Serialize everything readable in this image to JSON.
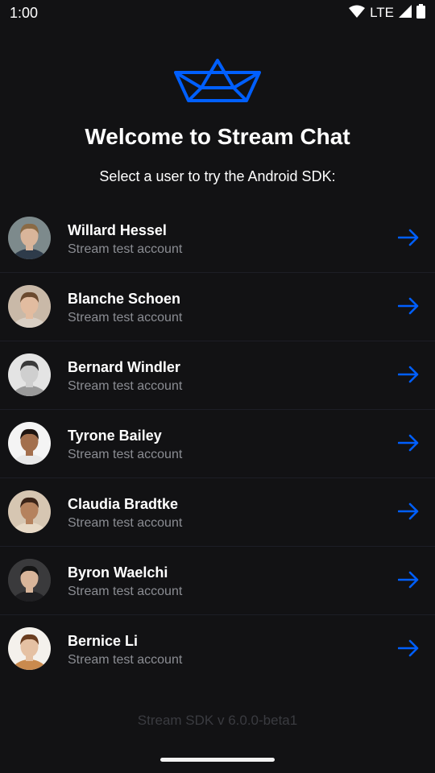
{
  "status_bar": {
    "time": "1:00",
    "network": "LTE",
    "icons": [
      "wifi-icon",
      "signal-icon",
      "battery-icon"
    ]
  },
  "logo_icon": "stream-boat-logo",
  "title": "Welcome to Stream Chat",
  "subtitle": "Select a user to try the Android SDK:",
  "users": [
    {
      "name": "Willard Hessel",
      "subtitle": "Stream test account",
      "skin": "#d9b59a",
      "hair": "#8a6a45",
      "bg": "#7d8a8c",
      "shirt": "#2e3b4a"
    },
    {
      "name": "Blanche Schoen",
      "subtitle": "Stream test account",
      "skin": "#e2bca0",
      "hair": "#6b4a2f",
      "bg": "#c9b9a8",
      "shirt": "#d9cfc4"
    },
    {
      "name": "Bernard Windler",
      "subtitle": "Stream test account",
      "skin": "#cfcfcf",
      "hair": "#3a3a3a",
      "bg": "#e4e4e4",
      "shirt": "#9a9a9a"
    },
    {
      "name": "Tyrone Bailey",
      "subtitle": "Stream test account",
      "skin": "#a36f4d",
      "hair": "#1e1410",
      "bg": "#f4f4f4",
      "shirt": "#e8e8e8"
    },
    {
      "name": "Claudia Bradtke",
      "subtitle": "Stream test account",
      "skin": "#b5825e",
      "hair": "#3b2418",
      "bg": "#d6c6b2",
      "shirt": "#e7d9c6"
    },
    {
      "name": "Byron Waelchi",
      "subtitle": "Stream test account",
      "skin": "#d8b59a",
      "hair": "#141414",
      "bg": "#3a3a3c",
      "shirt": "#1f1f22"
    },
    {
      "name": "Bernice Li",
      "subtitle": "Stream test account",
      "skin": "#e5c1a3",
      "hair": "#6a3d1f",
      "bg": "#f4f1ec",
      "shirt": "#c98a4e"
    }
  ],
  "row_action_icon": "arrow-right-icon",
  "footer": "Stream SDK v 6.0.0-beta1",
  "colors": {
    "background": "#121214",
    "accent": "#005fff",
    "secondary_text": "#8b8d93",
    "divider": "#1d1e26",
    "footer_text": "#3a3b40"
  }
}
